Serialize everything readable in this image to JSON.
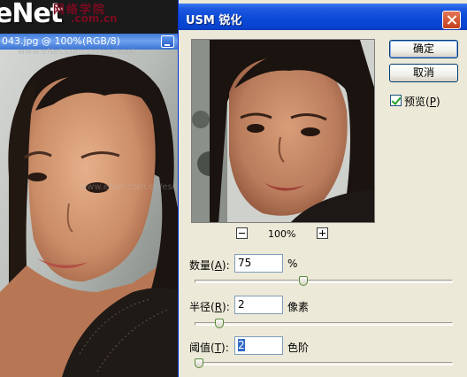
{
  "background": {
    "logo": "eNet",
    "site_cn": "网络学院",
    "site_url": ".com.cn",
    "watermark": "www.eNet.com.cn/eschool",
    "document_title": "043.jpg @ 100%(RGB/8)"
  },
  "dialog": {
    "title": "USM 锐化",
    "ok_label": "确定",
    "cancel_label": "取消",
    "preview_label": "预览",
    "preview_mnemonic": "P",
    "preview_checked": true,
    "zoom_level": "100%",
    "params": {
      "amount": {
        "label": "数量",
        "mnemonic": "A",
        "value": "75",
        "unit": "%",
        "slider_fraction": 0.42
      },
      "radius": {
        "label": "半径",
        "mnemonic": "R",
        "value": "2",
        "unit": "像素",
        "slider_fraction": 0.08
      },
      "threshold": {
        "label": "阈值",
        "mnemonic": "T",
        "value": "2",
        "unit": "色阶",
        "slider_fraction": 0.0
      }
    }
  },
  "colors": {
    "titlebar": "#0a48d6",
    "dialog_bg": "#ece9d8",
    "selection": "#316ac5"
  }
}
